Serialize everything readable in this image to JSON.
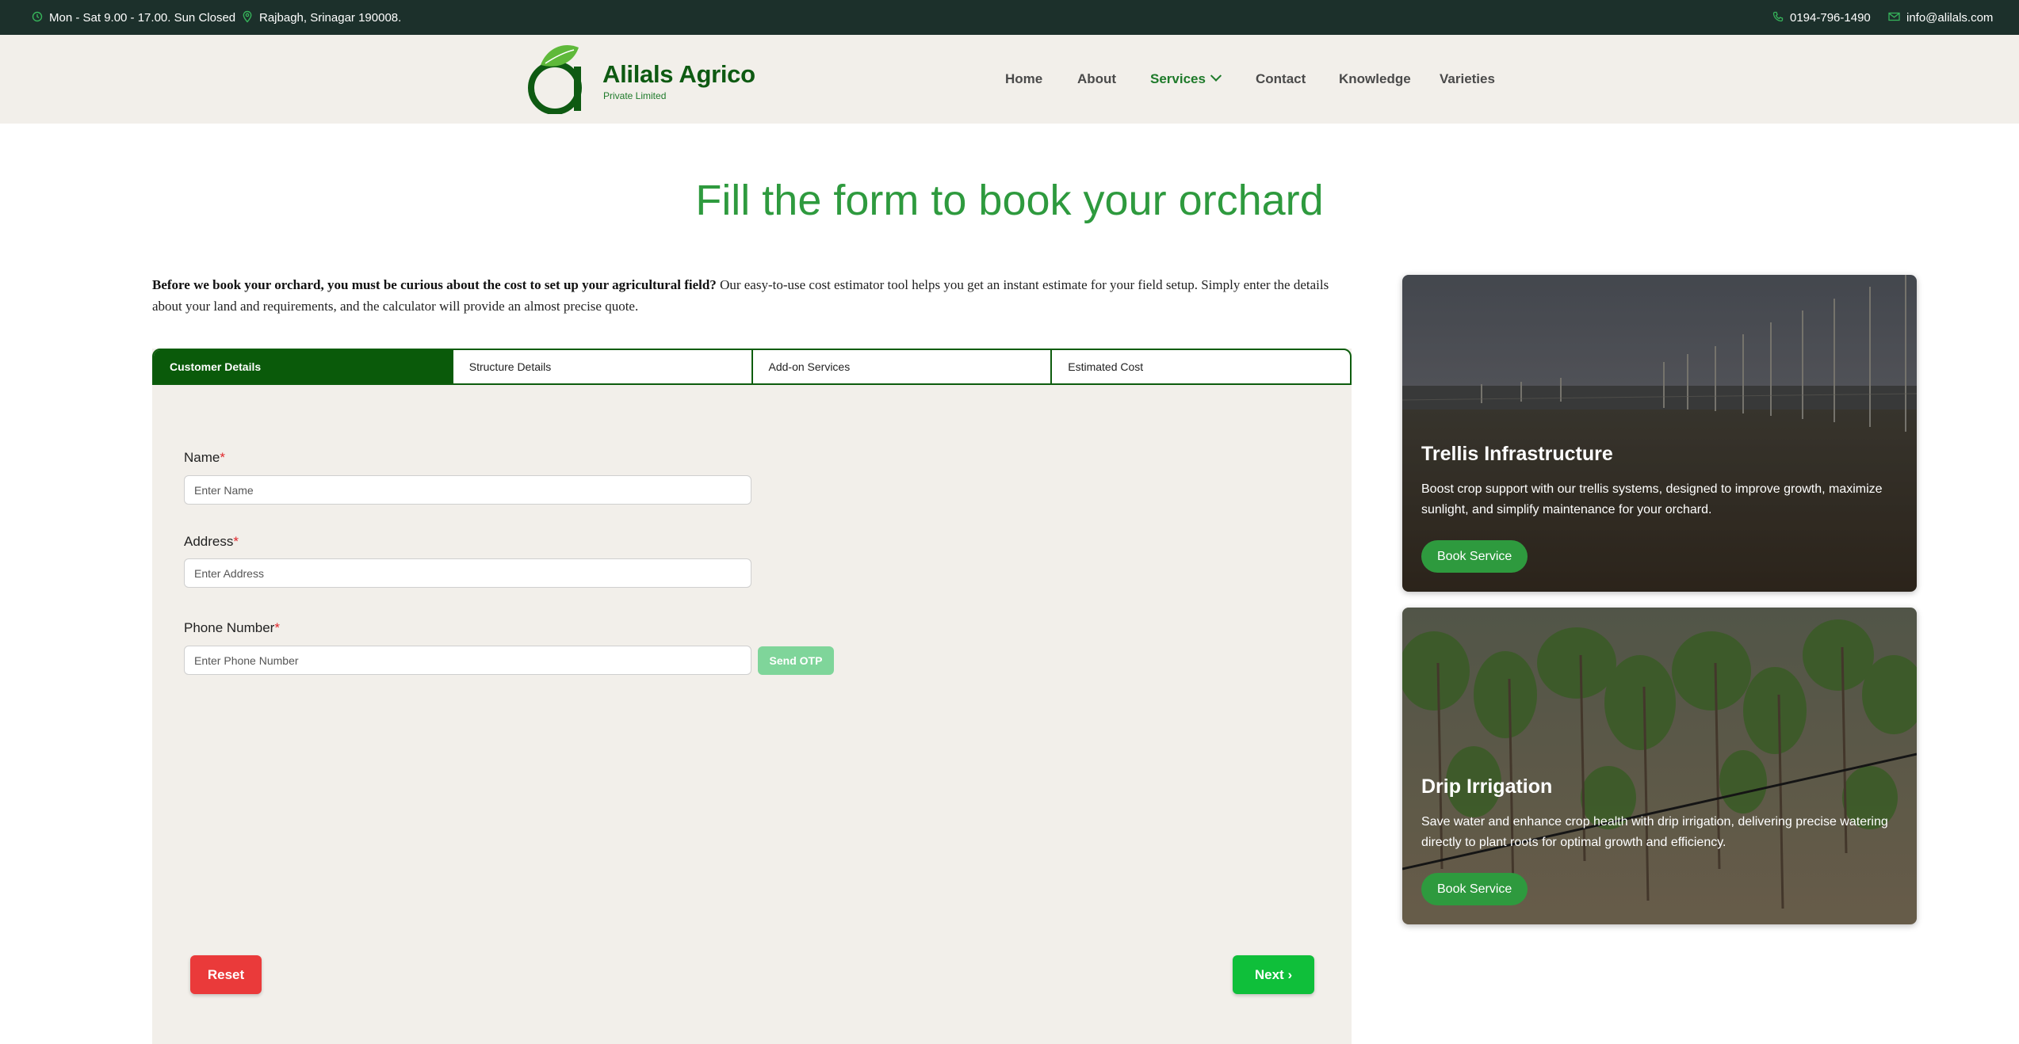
{
  "topbar": {
    "hours": "Mon - Sat 9.00 - 17.00. Sun Closed",
    "address": "Rajbagh, Srinagar 190008.",
    "phone": "0194-796-1490",
    "email": "info@alilals.com"
  },
  "brand": {
    "name": "Alilals Agrico",
    "subtitle": "Private Limited"
  },
  "nav": {
    "items": [
      "Home",
      "About",
      "Services",
      "Contact",
      "Knowledge",
      "Varieties"
    ],
    "active": "Services"
  },
  "page_title": "Fill the form to book your orchard",
  "intro": {
    "bold": "Before we book your orchard, you must be curious about the cost to set up your agricultural field?",
    "text": " Our easy-to-use cost estimator tool helps you get an instant estimate for your field setup. Simply enter the details about your land and requirements, and the calculator will provide an almost precise quote."
  },
  "tabs": [
    "Customer Details",
    "Structure Details",
    "Add-on Services",
    "Estimated Cost"
  ],
  "form": {
    "name_label": "Name",
    "name_placeholder": "Enter Name",
    "address_label": "Address",
    "address_placeholder": "Enter Address",
    "phone_label": "Phone Number",
    "phone_placeholder": "Enter Phone Number",
    "required_mark": "*",
    "send_otp": "Send OTP",
    "reset": "Reset",
    "next": "Next ›"
  },
  "cards": [
    {
      "title": "Trellis Infrastructure",
      "description": "Boost crop support with our trellis systems, designed to improve growth, maximize sunlight, and simplify maintenance for your orchard.",
      "button": "Book Service"
    },
    {
      "title": "Drip Irrigation",
      "description": "Save water and enhance crop health with drip irrigation, delivering precise watering directly to plant roots for optimal growth and efficiency.",
      "button": "Book Service"
    }
  ],
  "colors": {
    "topbar": "#1c302b",
    "header_bg": "#f2efea",
    "brand_green": "#0e5a12",
    "accent_green": "#2e9a3e",
    "tab_active": "#0a5a0a",
    "reset_red": "#ea3a3a",
    "next_green": "#0fbf3a",
    "otp_green": "#7fd59a"
  },
  "icons": {
    "hours": "clock-icon",
    "address": "location-pin-icon",
    "phone": "phone-icon",
    "email": "mail-icon",
    "services_dropdown": "chevron-down-icon"
  }
}
